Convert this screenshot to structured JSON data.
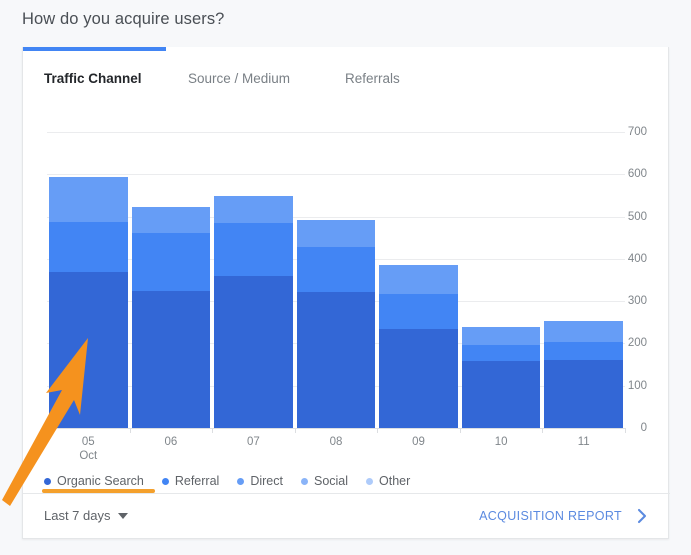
{
  "page": {
    "title": "How do you acquire users?"
  },
  "tabs": [
    {
      "label": "Traffic Channel",
      "active": true
    },
    {
      "label": "Source / Medium",
      "active": false
    },
    {
      "label": "Referrals",
      "active": false
    }
  ],
  "footer": {
    "date_range_label": "Last 7 days",
    "date_caret_icon": "chevron-down-icon",
    "report_link_label": "ACQUISITION REPORT",
    "report_chevron_icon": "chevron-right-icon"
  },
  "annotations": {
    "arrow_color": "#f5921e",
    "underline_color": "#f4a02c",
    "arrow_target": "Organic Search segment of 05 Oct bar",
    "underline_target": "Organic Search legend entry"
  },
  "chart_data": {
    "type": "bar",
    "stacked": true,
    "title": "How do you acquire users?",
    "xlabel": "",
    "ylabel": "",
    "ylim": [
      0,
      700
    ],
    "yticks": [
      0,
      100,
      200,
      300,
      400,
      500,
      600,
      700
    ],
    "ytick_labels": [
      "0",
      "100",
      "200",
      "300",
      "400",
      "500",
      "600",
      "700"
    ],
    "grid": true,
    "legend_position": "bottom",
    "categories": [
      "05",
      "06",
      "07",
      "08",
      "09",
      "10",
      "11"
    ],
    "category_sublabels": [
      "Oct",
      "",
      "",
      "",
      "",
      "",
      ""
    ],
    "series": [
      {
        "name": "Organic Search",
        "color": "#3367d6",
        "values": [
          368,
          325,
          359,
          321,
          235,
          159,
          161
        ]
      },
      {
        "name": "Referral",
        "color": "#4285f4",
        "values": [
          119,
          137,
          125,
          107,
          83,
          38,
          43
        ]
      },
      {
        "name": "Direct",
        "color": "#669df6",
        "values": [
          107,
          60,
          65,
          63,
          68,
          41,
          49
        ]
      },
      {
        "name": "Social",
        "color": "#8ab4f8",
        "values": [
          0,
          0,
          0,
          0,
          0,
          0,
          0
        ]
      },
      {
        "name": "Other",
        "color": "#aecbfa",
        "values": [
          0,
          0,
          0,
          0,
          0,
          0,
          0
        ]
      }
    ],
    "totals": [
      594,
      522,
      549,
      491,
      386,
      238,
      253
    ]
  }
}
